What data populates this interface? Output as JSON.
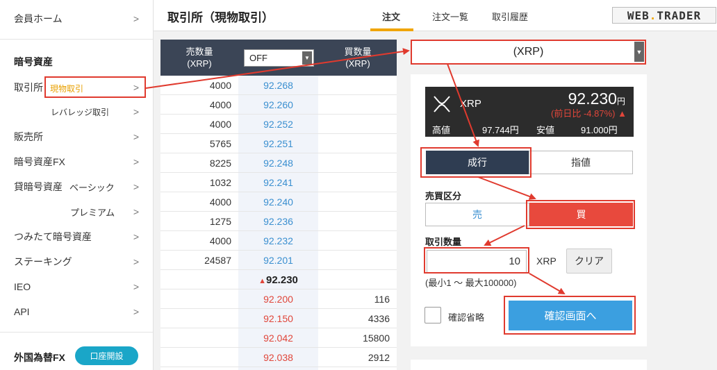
{
  "sidebar": {
    "member_home": "会員ホーム",
    "crypto_heading": "暗号資産",
    "exchange": "取引所",
    "spot": "現物取引",
    "leverage": "レバレッジ取引",
    "store": "販売所",
    "crypto_fx": "暗号資産FX",
    "lending": "貸暗号資産",
    "basic": "ベーシック",
    "premium": "プレミアム",
    "tsumitate": "つみたて暗号資産",
    "staking": "ステーキング",
    "ieo": "IEO",
    "api": "API",
    "fx_heading": "外国為替FX",
    "open_account": "口座開設",
    "chevron": ">"
  },
  "header": {
    "title": "取引所（現物取引）",
    "tabs": [
      "注文",
      "注文一覧",
      "取引履歴"
    ],
    "logo_left": "WEB",
    "logo_dot": ".",
    "logo_right": "TRADER"
  },
  "book": {
    "sell_qty_label": "売数量",
    "buy_qty_label": "買数量",
    "unit_label": "(XRP)",
    "off_select": "OFF",
    "asks": [
      {
        "qty": "4000",
        "price": "92.268"
      },
      {
        "qty": "4000",
        "price": "92.260"
      },
      {
        "qty": "4000",
        "price": "92.252"
      },
      {
        "qty": "5765",
        "price": "92.251"
      },
      {
        "qty": "8225",
        "price": "92.248"
      },
      {
        "qty": "1032",
        "price": "92.241"
      },
      {
        "qty": "4000",
        "price": "92.240"
      },
      {
        "qty": "1275",
        "price": "92.236"
      },
      {
        "qty": "4000",
        "price": "92.232"
      },
      {
        "qty": "24587",
        "price": "92.201"
      }
    ],
    "last_price": "92.230",
    "bids": [
      {
        "price": "92.200",
        "qty": "116"
      },
      {
        "price": "92.150",
        "qty": "4336"
      },
      {
        "price": "92.042",
        "qty": "15800"
      },
      {
        "price": "92.038",
        "qty": "2912"
      }
    ]
  },
  "order": {
    "symbol_select": "(XRP)",
    "symbol": "XRP",
    "price": "92.230",
    "yen": "円",
    "change": "(前日比 -4.87%)",
    "high_label": "高値",
    "high_value": "97.744円",
    "low_label": "安値",
    "low_value": "91.000円",
    "market": "成行",
    "limit": "指値",
    "side_label": "売買区分",
    "sell": "売",
    "buy": "買",
    "qty_label": "取引数量",
    "qty_value": "10",
    "qty_unit": "XRP",
    "clear": "クリア",
    "hint": "(最小1 〜 最大100000)",
    "skip_confirm": "確認省略",
    "confirm": "確認画面へ"
  },
  "colors": {
    "annotation": "#e03a2e",
    "accent": "#f0a500",
    "buy": "#e8493d",
    "confirm": "#3b9fe0",
    "book_header": "#3b4556"
  }
}
